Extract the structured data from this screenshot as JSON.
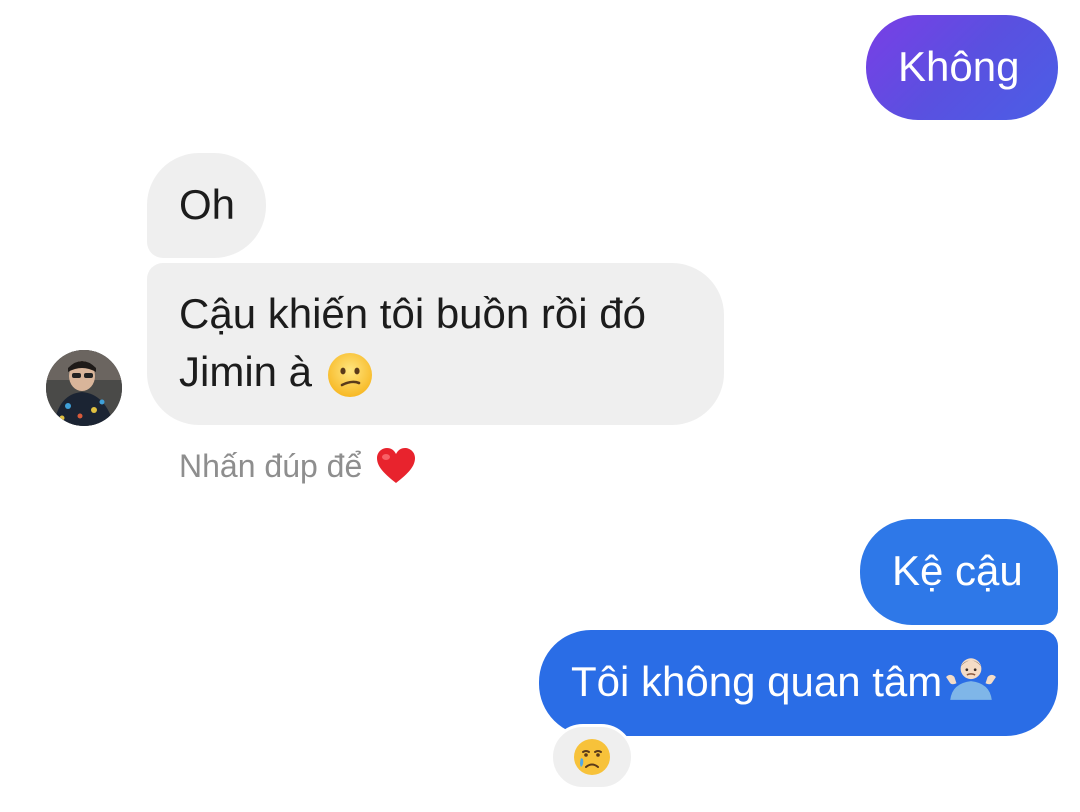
{
  "messages": {
    "out_1": "Không",
    "in_1": "Oh",
    "in_2_line1": "Cậu khiến tôi buồn rồi đó",
    "in_2_line2": "Jimin à",
    "in_2_emoji": "confused-face-icon",
    "out_2": "Kệ cậu",
    "out_3": "Tôi không quan tâm",
    "out_3_emoji": "person-shrugging-icon"
  },
  "hint": {
    "text": "Nhấn đúp để",
    "icon": "red-heart-icon"
  },
  "reaction": {
    "icon": "crying-face-icon"
  },
  "colors": {
    "outgoing_gradient_start": "#7a3ee6",
    "outgoing_gradient_end": "#4a5fe6",
    "outgoing_blue": "#2a6de6",
    "incoming_bg": "#efefef",
    "hint_text": "#8e8e8e",
    "heart": "#e8232d"
  }
}
